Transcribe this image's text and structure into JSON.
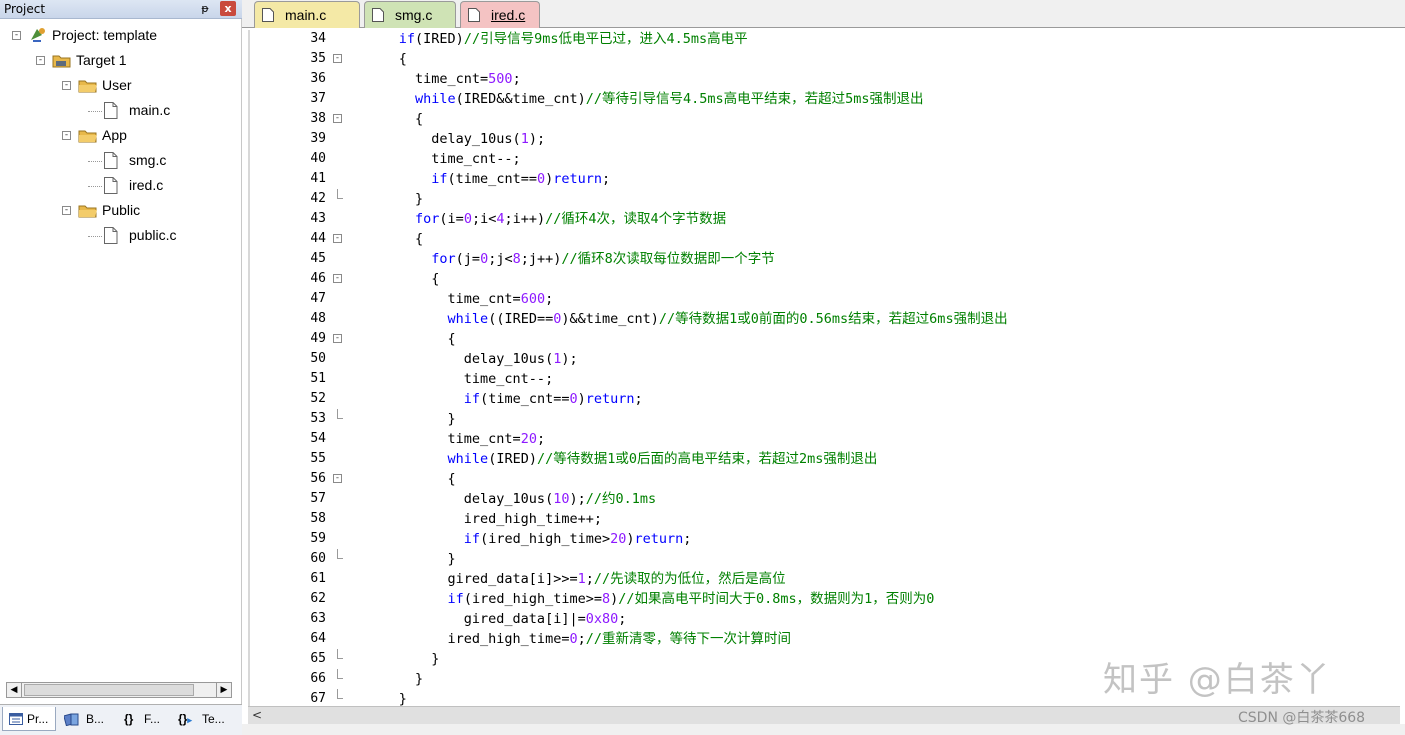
{
  "project_panel": {
    "title": "Project",
    "pin_glyph": "ᵽ",
    "close_glyph": "x",
    "tree": [
      {
        "label": "Project: template",
        "kind": "project",
        "depth": 0,
        "expanded": true
      },
      {
        "label": "Target 1",
        "kind": "target",
        "depth": 1,
        "expanded": true
      },
      {
        "label": "User",
        "kind": "folder",
        "depth": 2,
        "expanded": true
      },
      {
        "label": "main.c",
        "kind": "file",
        "depth": 3
      },
      {
        "label": "App",
        "kind": "folder",
        "depth": 2,
        "expanded": true
      },
      {
        "label": "smg.c",
        "kind": "file",
        "depth": 3
      },
      {
        "label": "ired.c",
        "kind": "file",
        "depth": 3
      },
      {
        "label": "Public",
        "kind": "folder",
        "depth": 2,
        "expanded": true
      },
      {
        "label": "public.c",
        "kind": "file",
        "depth": 3
      }
    ],
    "bottom_tabs": [
      {
        "label": "Pr...",
        "icon": "project-window-icon",
        "active": true
      },
      {
        "label": "B...",
        "icon": "books-icon",
        "active": false
      },
      {
        "label": "F...",
        "icon": "functions-braces-icon",
        "active": false
      },
      {
        "label": "Te...",
        "icon": "templates-icon",
        "active": false
      }
    ],
    "braces_glyph": "{}",
    "template_glyph": "{}"
  },
  "editor": {
    "tabs": [
      {
        "label": "main.c",
        "active": false,
        "color": "#f4e9a6"
      },
      {
        "label": "smg.c",
        "active": false,
        "color": "#cfe3b5"
      },
      {
        "label": "ired.c",
        "active": true,
        "color": "#f4c3c3"
      }
    ],
    "lines": [
      {
        "num": "34",
        "fold": "line",
        "tokens": [
          [
            "",
            "      "
          ],
          [
            "kw",
            "if"
          ],
          [
            "",
            "(IRED)"
          ],
          [
            "cm",
            "//引导信号9ms低电平已过，进入4.5ms高电平"
          ]
        ]
      },
      {
        "num": "35",
        "fold": "box",
        "tokens": [
          [
            "",
            "      {"
          ]
        ]
      },
      {
        "num": "36",
        "fold": "line",
        "tokens": [
          [
            "",
            "        time_cnt="
          ],
          [
            "num",
            "500"
          ],
          [
            "",
            ";"
          ]
        ]
      },
      {
        "num": "37",
        "fold": "line",
        "tokens": [
          [
            "",
            "        "
          ],
          [
            "kw",
            "while"
          ],
          [
            "",
            "(IRED&&time_cnt)"
          ],
          [
            "cm",
            "//等待引导信号4.5ms高电平结束，若超过5ms强制退出"
          ]
        ]
      },
      {
        "num": "38",
        "fold": "box",
        "tokens": [
          [
            "",
            "        {"
          ]
        ]
      },
      {
        "num": "39",
        "fold": "line",
        "tokens": [
          [
            "",
            "          delay_10us("
          ],
          [
            "num",
            "1"
          ],
          [
            "",
            ");"
          ]
        ]
      },
      {
        "num": "40",
        "fold": "line",
        "tokens": [
          [
            "",
            "          time_cnt--;"
          ]
        ]
      },
      {
        "num": "41",
        "fold": "line",
        "tokens": [
          [
            "",
            "          "
          ],
          [
            "kw",
            "if"
          ],
          [
            "",
            "(time_cnt=="
          ],
          [
            "num",
            "0"
          ],
          [
            "",
            ")"
          ],
          [
            "kw",
            "return"
          ],
          [
            "",
            ";"
          ]
        ]
      },
      {
        "num": "42",
        "fold": "end",
        "tokens": [
          [
            "",
            "        }"
          ]
        ]
      },
      {
        "num": "43",
        "fold": "line",
        "tokens": [
          [
            "",
            "        "
          ],
          [
            "kw",
            "for"
          ],
          [
            "",
            "(i="
          ],
          [
            "num",
            "0"
          ],
          [
            "",
            ";i<"
          ],
          [
            "num",
            "4"
          ],
          [
            "",
            ";i++)"
          ],
          [
            "cm",
            "//循环4次，读取4个字节数据"
          ]
        ]
      },
      {
        "num": "44",
        "fold": "box",
        "tokens": [
          [
            "",
            "        {"
          ]
        ]
      },
      {
        "num": "45",
        "fold": "line",
        "tokens": [
          [
            "",
            "          "
          ],
          [
            "kw",
            "for"
          ],
          [
            "",
            "(j="
          ],
          [
            "num",
            "0"
          ],
          [
            "",
            ";j<"
          ],
          [
            "num",
            "8"
          ],
          [
            "",
            ";j++)"
          ],
          [
            "cm",
            "//循环8次读取每位数据即一个字节"
          ]
        ]
      },
      {
        "num": "46",
        "fold": "box",
        "tokens": [
          [
            "",
            "          {"
          ]
        ]
      },
      {
        "num": "47",
        "fold": "line",
        "tokens": [
          [
            "",
            "            time_cnt="
          ],
          [
            "num",
            "600"
          ],
          [
            "",
            ";"
          ]
        ]
      },
      {
        "num": "48",
        "fold": "line",
        "tokens": [
          [
            "",
            "            "
          ],
          [
            "kw",
            "while"
          ],
          [
            "",
            "((IRED=="
          ],
          [
            "num",
            "0"
          ],
          [
            "",
            ")&&time_cnt)"
          ],
          [
            "cm",
            "//等待数据1或0前面的0.56ms结束，若超过6ms强制退出"
          ]
        ]
      },
      {
        "num": "49",
        "fold": "box",
        "tokens": [
          [
            "",
            "            {"
          ]
        ]
      },
      {
        "num": "50",
        "fold": "line",
        "tokens": [
          [
            "",
            "              delay_10us("
          ],
          [
            "num",
            "1"
          ],
          [
            "",
            ");"
          ]
        ]
      },
      {
        "num": "51",
        "fold": "line",
        "tokens": [
          [
            "",
            "              time_cnt--;"
          ]
        ]
      },
      {
        "num": "52",
        "fold": "line",
        "tokens": [
          [
            "",
            "              "
          ],
          [
            "kw",
            "if"
          ],
          [
            "",
            "(time_cnt=="
          ],
          [
            "num",
            "0"
          ],
          [
            "",
            ")"
          ],
          [
            "kw",
            "return"
          ],
          [
            "",
            ";"
          ]
        ]
      },
      {
        "num": "53",
        "fold": "end",
        "tokens": [
          [
            "",
            "            }"
          ]
        ]
      },
      {
        "num": "54",
        "fold": "line",
        "tokens": [
          [
            "",
            "            time_cnt="
          ],
          [
            "num",
            "20"
          ],
          [
            "",
            ";"
          ]
        ]
      },
      {
        "num": "55",
        "fold": "line",
        "tokens": [
          [
            "",
            "            "
          ],
          [
            "kw",
            "while"
          ],
          [
            "",
            "(IRED)"
          ],
          [
            "cm",
            "//等待数据1或0后面的高电平结束，若超过2ms强制退出"
          ]
        ]
      },
      {
        "num": "56",
        "fold": "box",
        "tokens": [
          [
            "",
            "            {"
          ]
        ]
      },
      {
        "num": "57",
        "fold": "line",
        "tokens": [
          [
            "",
            "              delay_10us("
          ],
          [
            "num",
            "10"
          ],
          [
            "",
            ");"
          ],
          [
            "cm",
            "//约0.1ms"
          ]
        ]
      },
      {
        "num": "58",
        "fold": "line",
        "tokens": [
          [
            "",
            "              ired_high_time++;"
          ]
        ]
      },
      {
        "num": "59",
        "fold": "line",
        "tokens": [
          [
            "",
            "              "
          ],
          [
            "kw",
            "if"
          ],
          [
            "",
            "(ired_high_time>"
          ],
          [
            "num",
            "20"
          ],
          [
            "",
            ")"
          ],
          [
            "kw",
            "return"
          ],
          [
            "",
            ";"
          ]
        ]
      },
      {
        "num": "60",
        "fold": "end",
        "tokens": [
          [
            "",
            "            }"
          ]
        ]
      },
      {
        "num": "61",
        "fold": "line",
        "tokens": [
          [
            "",
            "            gired_data[i]>>="
          ],
          [
            "num",
            "1"
          ],
          [
            "",
            ";"
          ],
          [
            "cm",
            "//先读取的为低位，然后是高位"
          ]
        ]
      },
      {
        "num": "62",
        "fold": "line",
        "tokens": [
          [
            "",
            "            "
          ],
          [
            "kw",
            "if"
          ],
          [
            "",
            "(ired_high_time>="
          ],
          [
            "num",
            "8"
          ],
          [
            "",
            ")"
          ],
          [
            "cm",
            "//如果高电平时间大于0.8ms，数据则为1，否则为0"
          ]
        ]
      },
      {
        "num": "63",
        "fold": "line",
        "tokens": [
          [
            "",
            "              gired_data[i]|="
          ],
          [
            "num",
            "0x80"
          ],
          [
            "",
            ";"
          ]
        ]
      },
      {
        "num": "64",
        "fold": "line",
        "tokens": [
          [
            "",
            "            ired_high_time="
          ],
          [
            "num",
            "0"
          ],
          [
            "",
            ";"
          ],
          [
            "cm",
            "//重新清零，等待下一次计算时间"
          ]
        ]
      },
      {
        "num": "65",
        "fold": "end",
        "tokens": [
          [
            "",
            "          }"
          ]
        ]
      },
      {
        "num": "66",
        "fold": "end",
        "tokens": [
          [
            "",
            "        }"
          ]
        ]
      },
      {
        "num": "67",
        "fold": "end",
        "tokens": [
          [
            "",
            "      }"
          ]
        ]
      }
    ],
    "scroll_left_glyph": "<"
  },
  "watermark": "知乎 @白茶丫",
  "credit": "CSDN @白茶茶668",
  "colors": {
    "keyword": "#0000ff",
    "number": "#8d19ff",
    "comment": "#008000",
    "folder": "#e8b84a"
  }
}
